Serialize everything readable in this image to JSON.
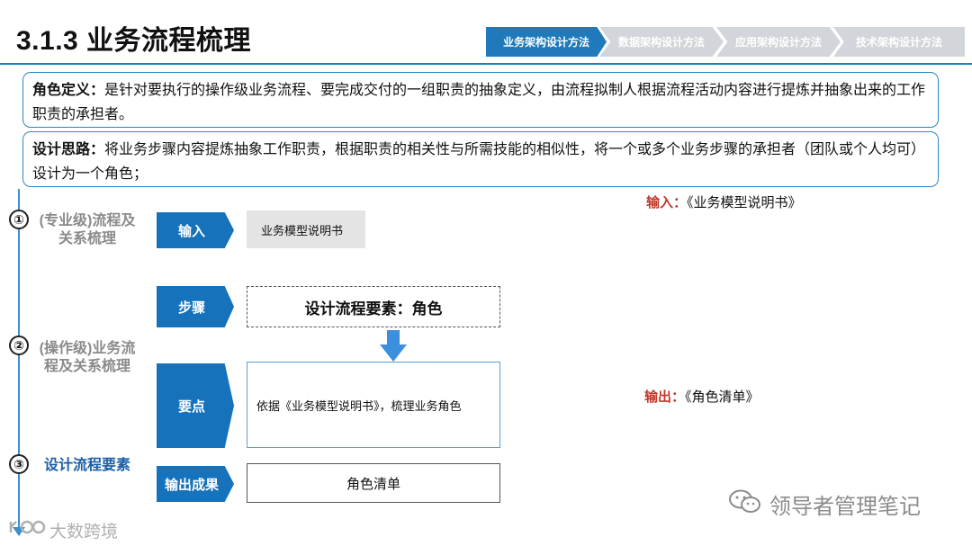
{
  "header": {
    "title": "3.1.3 业务流程梳理",
    "nav": [
      "业务架构设计方法",
      "数据架构设计方法",
      "应用架构设计方法",
      "技术架构设计方法"
    ],
    "active_index": 0
  },
  "definitions": [
    {
      "label": "角色定义：",
      "text": "是针对要执行的操作级业务流程、要完成交付的一组职责的抽象定义，由流程拟制人根据流程活动内容进行提炼并抽象出来的工作职责的承担者。"
    },
    {
      "label": "设计思路：",
      "text": "将业务步骤内容提炼抽象工作职责，根据职责的相关性与所需技能的相似性，将一个或多个业务步骤的承担者（团队或个人均可）设计为一个角色；"
    }
  ],
  "timeline": [
    {
      "number": "①",
      "label": "(专业级)流程及关系梳理"
    },
    {
      "number": "②",
      "label": "(操作级)业务流程及关系梳理"
    },
    {
      "number": "③",
      "label": "设计流程要素"
    }
  ],
  "flow": {
    "input_tag": "输入",
    "input_value": "业务模型说明书",
    "step_tag": "步骤",
    "step_value": "设计流程要素：角色",
    "key_tag": "要点",
    "key_value": "依据《业务模型说明书》，梳理业务角色",
    "output_tag": "输出成果",
    "output_value": "角色清单"
  },
  "io": {
    "input_label": "输入：",
    "input_value": "《业务模型说明书》",
    "output_label": "输出：",
    "output_value": "《角色清单》"
  },
  "watermarks": {
    "right": "领导者管理笔记",
    "left": "大数跨境"
  },
  "colors": {
    "primary": "#1572bb",
    "rule": "#1d7fb8",
    "highlight_red": "#c0392b",
    "phase_current": "#1b5ea8",
    "phase_inactive": "#8a8a8a"
  }
}
